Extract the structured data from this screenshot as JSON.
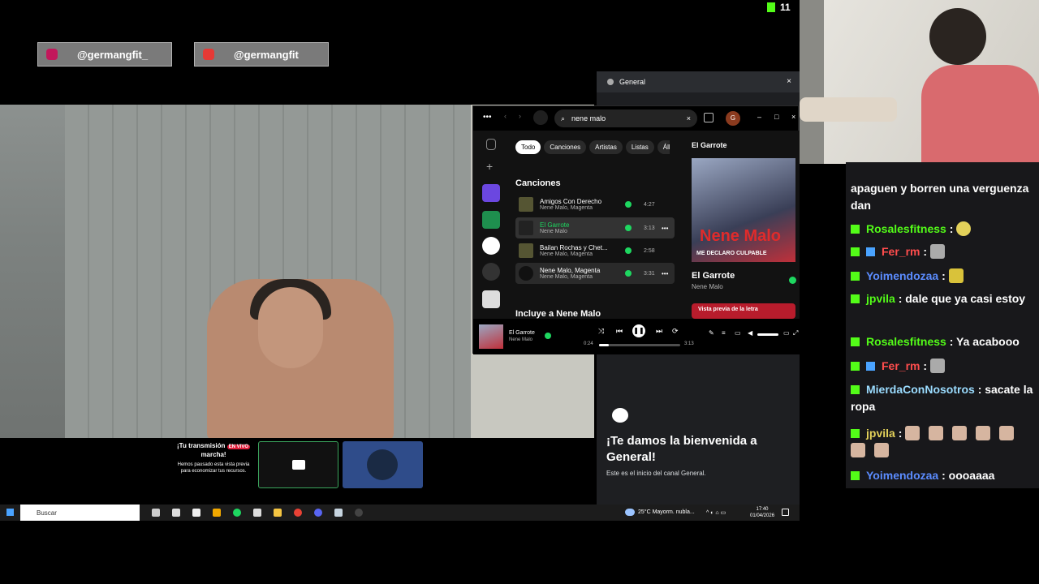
{
  "overlay": {
    "kick_count": "11",
    "social": [
      {
        "handle": "@germangfit_",
        "color": "#c2185b"
      },
      {
        "handle": "@germangfit",
        "color": "#e53935"
      }
    ]
  },
  "spotify": {
    "search_value": "nene malo",
    "filters": [
      "Todo",
      "Canciones",
      "Artistas",
      "Listas",
      "Álbu"
    ],
    "songs_heading": "Canciones",
    "songs": [
      {
        "title": "Amigos Con Derecho",
        "artist": "Nene Malo, Magenta",
        "duration": "4:27"
      },
      {
        "title": "El Garrote",
        "artist": "Nene Malo",
        "duration": "3:13"
      },
      {
        "title": "Bailan Rochas y Chet...",
        "artist": "Nene Malo, Magenta",
        "duration": "2:58"
      },
      {
        "title": "Nene Malo, Magenta",
        "artist": "Nene Malo, Magenta",
        "duration": "3:31"
      }
    ],
    "includes_heading": "Incluye a Nene Malo",
    "panel_title": "El Garrote",
    "album_text": "Nene Malo",
    "album_subtext": "ME DECLARO CULPABLE",
    "now_title": "El Garrote",
    "now_artist": "Nene Malo",
    "lyrics_preview": "Vista previa de la letra",
    "player": {
      "current": "0:24",
      "total": "3:13",
      "progress": 0.12
    },
    "avatar_letter": "G",
    "accent": "#1ed760"
  },
  "discord": {
    "channel": "General",
    "welcome": "¡Te damos la bienvenida a General!",
    "sub": "Este es el inicio del canal General."
  },
  "stream_notice": {
    "line1": "¡Tu transmisión",
    "badge": "EN VIVO",
    "line1b": "marcha!",
    "body": "Hemos pausado esta vista previa para economizar tus recursos."
  },
  "chat": [
    {
      "user": "",
      "text": "apaguen y borren una verguenza dan"
    },
    {
      "user": "Rosalesfitness",
      "text": ":"
    },
    {
      "user": "Fer_rm",
      "text": ":"
    },
    {
      "user": "Yoimendozaa",
      "text": ":"
    },
    {
      "user": "jpvila",
      "text": ": dale que ya casi estoy"
    },
    {
      "user": "Rosalesfitness",
      "text": ": Ya acabooo"
    },
    {
      "user": "Fer_rm",
      "text": ":"
    },
    {
      "user": "MierdaConNosotros",
      "text": ": sacate la ropa"
    },
    {
      "user": "jpvila",
      "text": ":"
    },
    {
      "user": "Yoimendozaa",
      "text": ": oooaaaa"
    }
  ],
  "chat_colors": {
    "green": "#53fc18",
    "blue": "#5b8cff",
    "red": "#ff4d4d"
  },
  "taskbar": {
    "search_placeholder": "Buscar",
    "weather": "25°C  Mayorm. nubla...",
    "time": "17:40",
    "date": "01/04/2026"
  }
}
